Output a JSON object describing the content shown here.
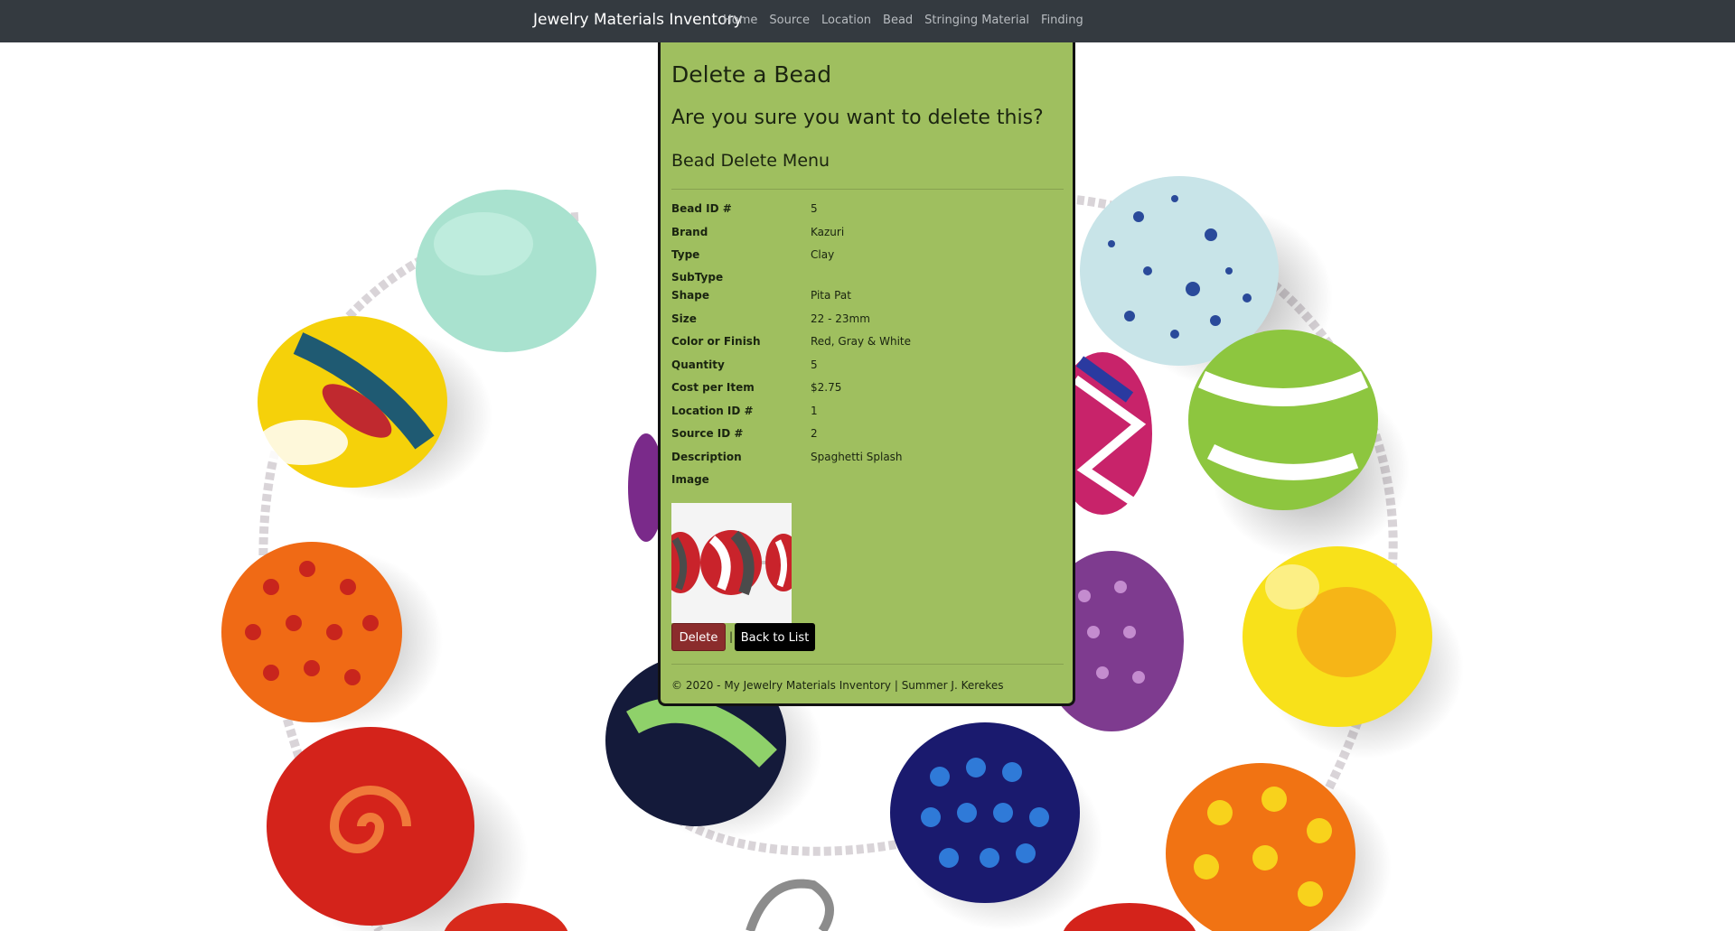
{
  "navbar": {
    "brand": "Jewelry Materials Inventory",
    "links": [
      "Home",
      "Source",
      "Location",
      "Bead",
      "Stringing Material",
      "Finding"
    ]
  },
  "page": {
    "title": "Delete a Bead",
    "confirm_question": "Are you sure you want to delete this?",
    "section_title": "Bead Delete Menu"
  },
  "details": [
    {
      "label": "Bead ID #",
      "value": "5"
    },
    {
      "label": "Brand",
      "value": "Kazuri"
    },
    {
      "label": "Type",
      "value": "Clay"
    },
    {
      "label": "SubType",
      "value": ""
    },
    {
      "label": "Shape",
      "value": "Pita Pat"
    },
    {
      "label": "Size",
      "value": "22 - 23mm"
    },
    {
      "label": "Color or Finish",
      "value": "Red, Gray & White"
    },
    {
      "label": "Quantity",
      "value": "5"
    },
    {
      "label": "Cost per Item",
      "value": "$2.75"
    },
    {
      "label": "Location ID #",
      "value": "1"
    },
    {
      "label": "Source ID #",
      "value": "2"
    },
    {
      "label": "Description",
      "value": "Spaghetti Splash"
    },
    {
      "label": "Image",
      "value": ""
    }
  ],
  "actions": {
    "delete_label": "Delete",
    "separator": "|",
    "back_label": "Back to List"
  },
  "footer": {
    "text": "© 2020 - My Jewelry Materials Inventory | Summer J. Kerekes"
  },
  "colors": {
    "navbar_bg": "#343a40",
    "card_bg": "#9fbf5f",
    "delete_button": "#8b2c2c",
    "back_button": "#000000"
  }
}
